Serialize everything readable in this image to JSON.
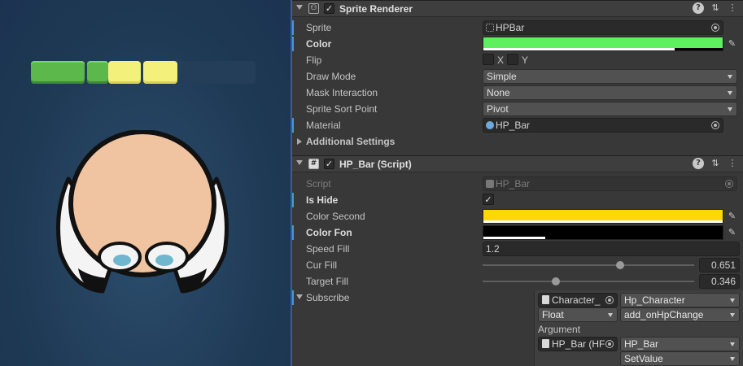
{
  "sprite_renderer": {
    "title": "Sprite Renderer",
    "enabled": true,
    "sprite": {
      "label": "Sprite",
      "value": "HPBar"
    },
    "color": {
      "label": "Color",
      "hex": "#5ef05e",
      "alpha": 0.8
    },
    "flip": {
      "label": "Flip",
      "x_label": "X",
      "y_label": "Y",
      "x": false,
      "y": false
    },
    "draw_mode": {
      "label": "Draw Mode",
      "value": "Simple"
    },
    "mask_interaction": {
      "label": "Mask Interaction",
      "value": "None"
    },
    "sort_point": {
      "label": "Sprite Sort Point",
      "value": "Pivot"
    },
    "material": {
      "label": "Material",
      "value": "HP_Bar"
    },
    "additional_settings": "Additional Settings"
  },
  "hp_bar_script": {
    "title": "HP_Bar (Script)",
    "enabled": true,
    "script": {
      "label": "Script",
      "value": "HP_Bar"
    },
    "is_hide": {
      "label": "Is Hide",
      "checked": true
    },
    "color_second": {
      "label": "Color Second",
      "hex": "#ffd800",
      "alpha": 1.0
    },
    "color_fon": {
      "label": "Color Fon",
      "hex": "#000000",
      "alpha": 0.26
    },
    "speed_fill": {
      "label": "Speed Fill",
      "value": "1.2"
    },
    "cur_fill": {
      "label": "Cur Fill",
      "value": "0.651",
      "fraction": 0.651
    },
    "target_fill": {
      "label": "Target Fill",
      "value": "0.346",
      "fraction": 0.346
    },
    "subscribe": {
      "label": "Subscribe",
      "target_object": "Character_",
      "method": "Hp_Character",
      "param_type": "Float",
      "event": "add_onHpChange",
      "argument_label": "Argument",
      "argument_object": "HP_Bar (HF",
      "argument_type": "HP_Bar",
      "argument_method": "SetValue"
    }
  },
  "scene": {
    "hp_fill": 0.651,
    "hp_target": 0.346
  }
}
